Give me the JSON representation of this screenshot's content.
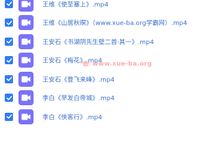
{
  "files": [
    {
      "name": "王维《使至塞上》.mp4",
      "checked": true
    },
    {
      "name": "王维《山居秋暝》（www.xue-ba.org学霸网）.mp4",
      "checked": true
    },
    {
      "name": "王安石《书湖阴先生壁二首·其一》.mp4",
      "checked": true
    },
    {
      "name": "王安石《梅花》.mp4",
      "checked": true
    },
    {
      "name": "王安石《登飞来峰》.mp4",
      "checked": true
    },
    {
      "name": "李白《早发白帝城》.mp4",
      "checked": true
    },
    {
      "name": "李白《侠客行》.mp4",
      "checked": true
    }
  ],
  "watermark": {
    "text": "www.xue-ba.org",
    "icon": "graduation-cap-icon"
  },
  "colors": {
    "checkbox": "#2f7bf6",
    "file_icon": "#7b72f7",
    "file_name": "#3a6fc8"
  },
  "icons": {
    "checkbox": "checkmark-icon",
    "file": "video-file-icon"
  }
}
